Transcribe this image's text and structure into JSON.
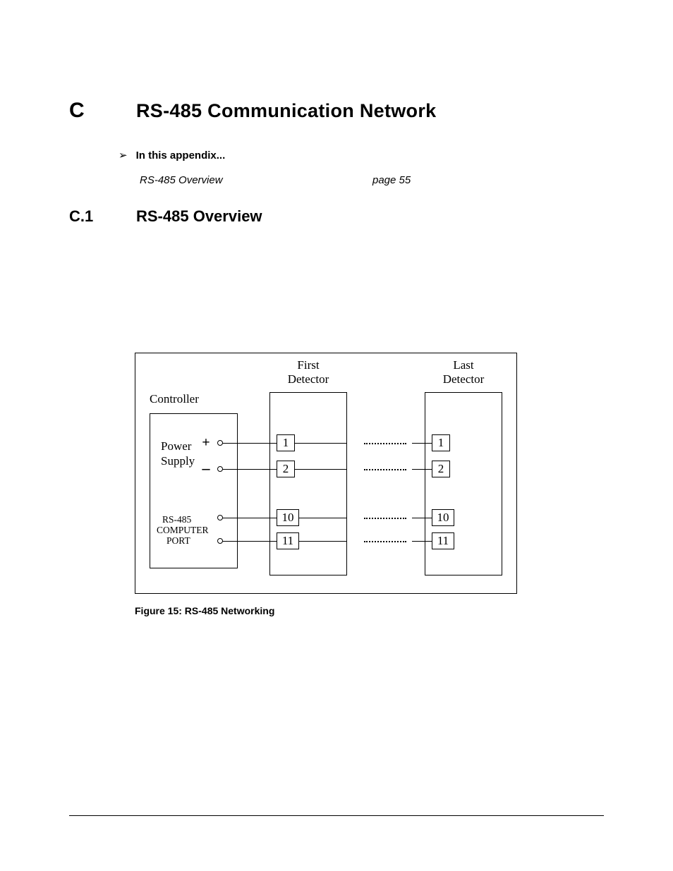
{
  "heading": {
    "letter": "C",
    "title": "RS-485 Communication Network"
  },
  "toc": {
    "bullet": "➢",
    "intro": "In this appendix...",
    "entry_label": "RS-485 Overview",
    "entry_page": "page 55"
  },
  "subheading": {
    "num": "C.1",
    "title": "RS-485 Overview"
  },
  "diagram": {
    "controller": "Controller",
    "first_detector": "First\nDetector",
    "last_detector": "Last\nDetector",
    "power": "Power",
    "supply": "Supply",
    "plus": "+",
    "minus": "–",
    "port_l1": "RS-485",
    "port_l2": "COMPUTER",
    "port_l3": "PORT",
    "pins": {
      "p1": "1",
      "p2": "2",
      "p10": "10",
      "p11": "11"
    }
  },
  "caption": "Figure 15: RS-485 Networking"
}
